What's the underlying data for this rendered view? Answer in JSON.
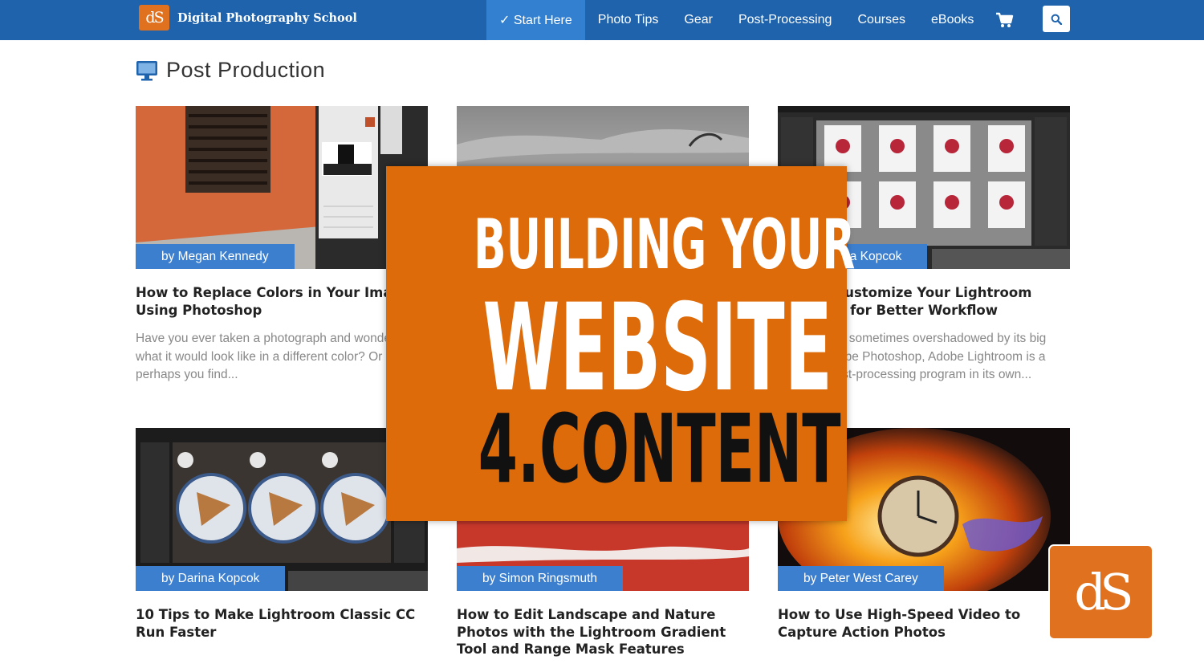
{
  "header": {
    "brand_mark": "dS",
    "brand_name": "Digital Photography School",
    "nav": [
      "✓ Start Here",
      "Photo Tips",
      "Gear",
      "Post-Processing",
      "Courses",
      "eBooks"
    ],
    "cart_icon": "cart-icon",
    "search_icon": "search-icon",
    "colors": {
      "bar": "#1f63ad",
      "active": "#3380d0"
    }
  },
  "page": {
    "title": "Post Production",
    "icon": "monitor-icon"
  },
  "cards": [
    {
      "author": "by Megan Kennedy",
      "title": "How to Replace Colors in Your Images Using Photoshop",
      "excerpt": "Have you ever taken a photograph and wondered what it would look like in a different color? Or perhaps you find..."
    },
    {
      "author": "",
      "title": "",
      "excerpt": ""
    },
    {
      "author": "by Darina Kopcok",
      "title": "How to Customize Your Lightroom Interface for Better Workflow",
      "excerpt": "Lightroom is sometimes overshadowed by its big brother, Adobe Photoshop, Adobe Lightroom is a powerful post-processing program in its own..."
    },
    {
      "author": "by Darina Kopcok",
      "title": "10 Tips to Make Lightroom Classic CC Run Faster",
      "excerpt": ""
    },
    {
      "author": "by Simon Ringsmuth",
      "title": "How to Edit Landscape and Nature Photos with the Lightroom Gradient Tool and Range Mask Features",
      "excerpt": ""
    },
    {
      "author": "by Peter West Carey",
      "title": "How to Use High-Speed Video to Capture Action Photos",
      "excerpt": ""
    }
  ],
  "overlay": {
    "line1": "BUILDING YOUR",
    "line2": "WEBSITE",
    "line3": "4.CONTENT",
    "color": "#de6b0a"
  },
  "badge": {
    "mark": "dS"
  }
}
